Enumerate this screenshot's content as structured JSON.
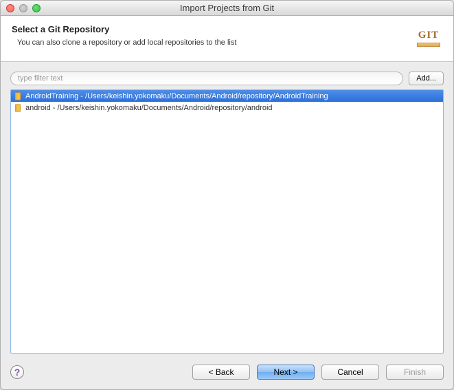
{
  "window": {
    "title": "Import Projects from Git"
  },
  "header": {
    "heading": "Select a Git Repository",
    "subtext": "You can also clone a repository or add local repositories to the list",
    "logo_text": "GIT"
  },
  "filter": {
    "placeholder": "type filter text",
    "add_label": "Add..."
  },
  "repos": [
    {
      "name": "AndroidTraining",
      "path": "/Users/keishin.yokomaku/Documents/Android/repository/AndroidTraining",
      "selected": true
    },
    {
      "name": "android",
      "path": "/Users/keishin.yokomaku/Documents/Android/repository/android",
      "selected": false
    }
  ],
  "footer": {
    "back": "< Back",
    "next": "Next >",
    "cancel": "Cancel",
    "finish": "Finish"
  }
}
